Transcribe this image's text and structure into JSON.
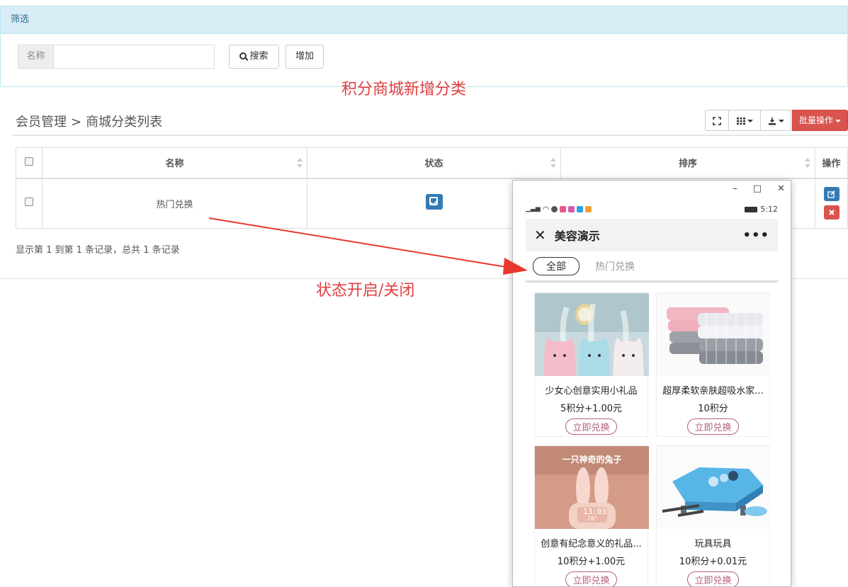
{
  "filter": {
    "title": "筛选",
    "name_label": "名称",
    "name_value": "",
    "search_label": "搜索",
    "add_label": "增加"
  },
  "annotations": {
    "note_top": "积分商城新增分类",
    "note_status": "状态开启/关闭"
  },
  "breadcrumb": {
    "parent": "会员管理",
    "separator": ">",
    "current": "商城分类列表"
  },
  "toolbar": {
    "batch_label": "批量操作"
  },
  "table": {
    "headers": [
      "名称",
      "状态",
      "排序",
      "操作"
    ],
    "rows": [
      {
        "name": "热门兑换",
        "status_enabled": true,
        "sort": ""
      }
    ]
  },
  "summary": "显示第 1 到第 1 条记录，总共 1 条记录",
  "phone": {
    "time": "5:12",
    "title": "美容演示",
    "tabs": [
      "全部",
      "热门兑换"
    ],
    "products": [
      {
        "name": "少女心创意实用小礼品",
        "price": "5积分+1.00元",
        "button": "立即兑换"
      },
      {
        "name": "超厚柔软亲肤超吸水家...",
        "price": "10积分",
        "button": "立即兑换"
      },
      {
        "name": "创意有纪念意义的礼品...",
        "price": "10积分+1.00元",
        "button": "立即兑换",
        "img_text": "一只神奇的兔子",
        "img_clock": "13:03",
        "img_sub": "26°"
      },
      {
        "name": "玩具玩具",
        "price": "10积分+0.01元",
        "button": "立即兑换"
      }
    ]
  }
}
